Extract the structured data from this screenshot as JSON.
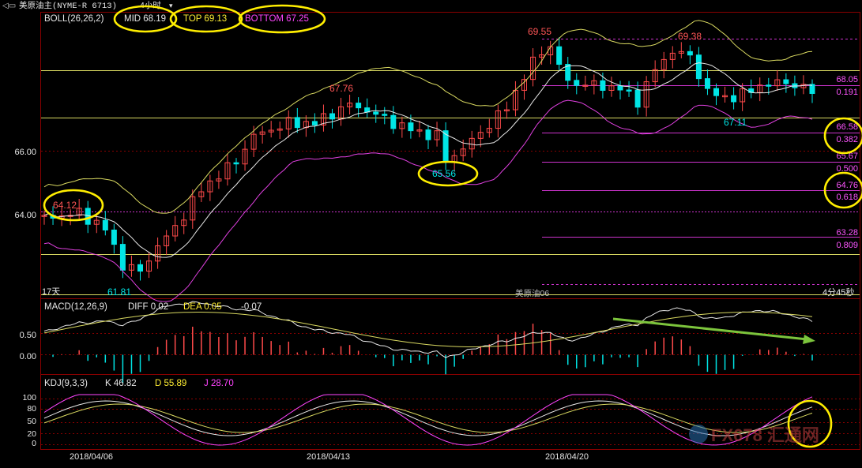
{
  "header": {
    "instrument": "美原油主(NYME-R 6713)",
    "period": "4小时",
    "back_label": "◁▭"
  },
  "boll": {
    "label": "BOLL(26,26,2)",
    "mid_label": "MID 68.19",
    "top_label": "TOP 69.13",
    "bottom_label": "BOTTOM 67.25"
  },
  "macd": {
    "label": "MACD(12,26,9)",
    "diff_label": "DIFF 0.02",
    "dea_label": "DEA 0.05",
    "hist_label": "-0.07"
  },
  "kdj": {
    "label": "KDJ(9,3,3)",
    "k_label": "K 46.82",
    "d_label": "D 55.89",
    "j_label": "J 28.70"
  },
  "x_dates": [
    "2018/04/06",
    "2018/04/13",
    "2018/04/20"
  ],
  "price_axis": {
    "ticks": [
      "66.00",
      "64.00"
    ]
  },
  "macd_axis": {
    "ticks": [
      "0.50",
      "0.00"
    ]
  },
  "kdj_axis": {
    "ticks": [
      "100",
      "80",
      "50",
      "20",
      "0"
    ]
  },
  "fib_labels": [
    {
      "price": "68.05",
      "ratio": "0.191"
    },
    {
      "price": "66.58",
      "ratio": "0.382"
    },
    {
      "price": "65.67",
      "ratio": "0.500"
    },
    {
      "price": "64.76",
      "ratio": "0.618"
    },
    {
      "price": "63.28",
      "ratio": "0.809"
    }
  ],
  "annotations": {
    "high_1": "69.55",
    "high_2": "69.38",
    "mid_high": "67.76",
    "low_left": "64.12",
    "low_bottom": "61.81",
    "low_mid": "65.56",
    "low_right": "67.11"
  },
  "status": {
    "days": "17天",
    "watermark": "美原油06",
    "countdown": "4分45秒"
  },
  "logo": {
    "text": "FX678 汇通网"
  },
  "colors": {
    "up": "#ff4a4a",
    "down": "#00e5e5",
    "boll_upper": "#d8d860",
    "boll_mid": "#e8e8e8",
    "boll_lower": "#e040e0",
    "highlight": "#ffee00",
    "arrow": "#7cc43c"
  },
  "chart_data": [
    {
      "type": "candlestick",
      "title": "美原油主(NYME-R 6713) 4小时",
      "x": [
        "2018/04/06",
        "2018/04/13",
        "2018/04/20"
      ],
      "y_ticks": [
        64.0,
        66.0
      ],
      "indicator": "BOLL(26,26,2)",
      "mid": 68.19,
      "top": 69.13,
      "bottom": 67.25,
      "labeled_points": {
        "high_1": 69.55,
        "high_2": 69.38,
        "mid_high": 67.76,
        "low_left": 64.12,
        "low_bottom": 61.81,
        "low_mid": 65.56,
        "low_right": 67.11
      },
      "fibonacci": [
        {
          "ratio": 0.191,
          "price": 68.05
        },
        {
          "ratio": 0.382,
          "price": 66.58
        },
        {
          "ratio": 0.5,
          "price": 65.67
        },
        {
          "ratio": 0.618,
          "price": 64.76
        },
        {
          "ratio": 0.809,
          "price": 63.28
        }
      ]
    },
    {
      "type": "bar",
      "title": "MACD(12,26,9)",
      "diff": 0.02,
      "dea": 0.05,
      "macd": -0.07,
      "y_ticks": [
        0.0,
        0.5
      ]
    },
    {
      "type": "line",
      "title": "KDJ(9,3,3)",
      "k": 46.82,
      "d": 55.89,
      "j": 28.7,
      "y_ticks": [
        0,
        20,
        50,
        80,
        100
      ]
    }
  ]
}
